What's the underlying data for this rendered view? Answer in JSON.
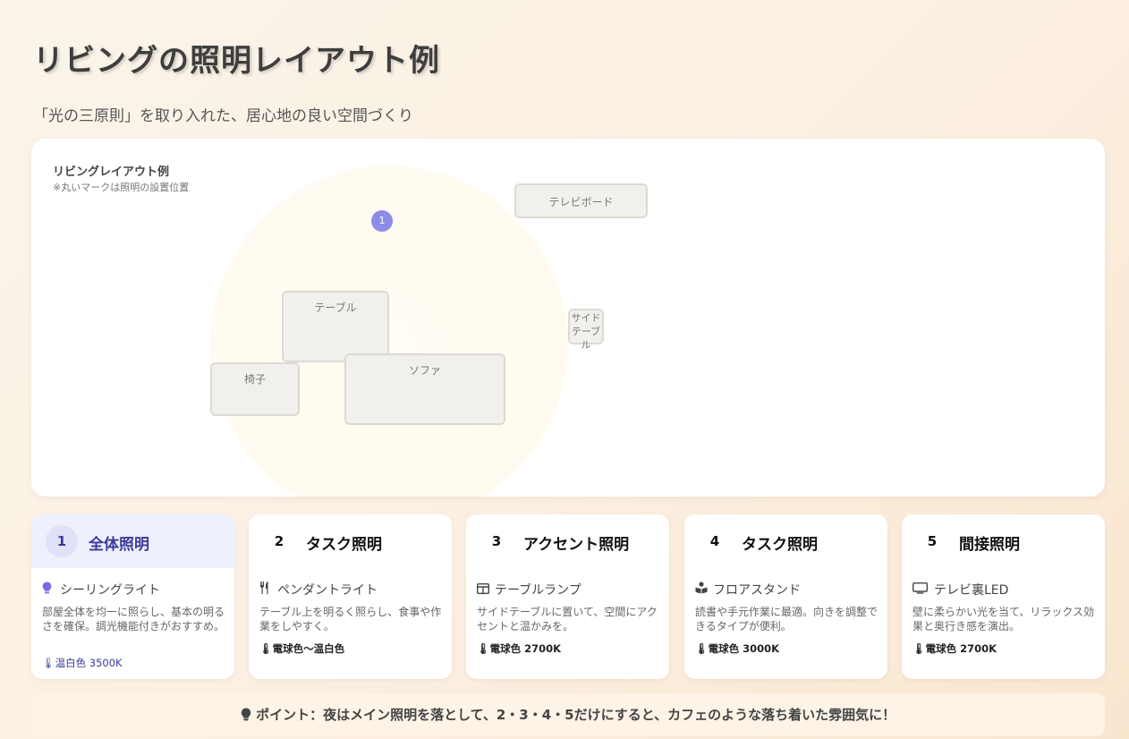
{
  "header": {
    "title": "リビングの照明レイアウト例",
    "subtitle": "「光の三原則」を取り入れた、居心地の良い空間づくり"
  },
  "layout": {
    "title": "リビングレイアウト例",
    "note": "※丸いマークは照明の設置位置",
    "furniture": {
      "tv_board": "テレビボード",
      "table": "テーブル",
      "chair": "椅子",
      "sofa": "ソファ",
      "side_table": "サイドテーブル"
    },
    "markers": [
      "1"
    ]
  },
  "cards": [
    {
      "num": "1",
      "title": "全体照明",
      "icon": "lightbulb-icon",
      "fixture": "シーリングライト",
      "desc": "部屋全体を均一に照らし、基本の明るさを確保。調光機能付きがおすすめ。",
      "color": "温白色 3500K",
      "active": true
    },
    {
      "num": "2",
      "title": "タスク照明",
      "icon": "utensils-icon",
      "fixture": "ペンダントライト",
      "desc": "テーブル上を明るく照らし、食事や作業をしやすく。",
      "color": "電球色〜温白色",
      "active": false
    },
    {
      "num": "3",
      "title": "アクセント照明",
      "icon": "table-icon",
      "fixture": "テーブルランプ",
      "desc": "サイドテーブルに置いて、空間にアクセントと温かみを。",
      "color": "電球色 2700K",
      "active": false
    },
    {
      "num": "4",
      "title": "タスク照明",
      "icon": "book-reader-icon",
      "fixture": "フロアスタンド",
      "desc": "読書や手元作業に最適。向きを調整できるタイプが便利。",
      "color": "電球色 3000K",
      "active": false
    },
    {
      "num": "5",
      "title": "間接照明",
      "icon": "tv-icon",
      "fixture": "テレビ裏LED",
      "desc": "壁に柔らかい光を当て、リラックス効果と奥行き感を演出。",
      "color": "電球色 2700K",
      "active": false
    }
  ],
  "tip": {
    "icon": "lightbulb-icon",
    "text": "ポイント：夜はメイン照明を落として、2・3・4・5だけにすると、カフェのような落ち着いた雰囲気に！"
  },
  "colors": {
    "accent": "#3a3a9a",
    "marker": "#8c8ce8",
    "active_card_bg": "#eef0fb"
  }
}
